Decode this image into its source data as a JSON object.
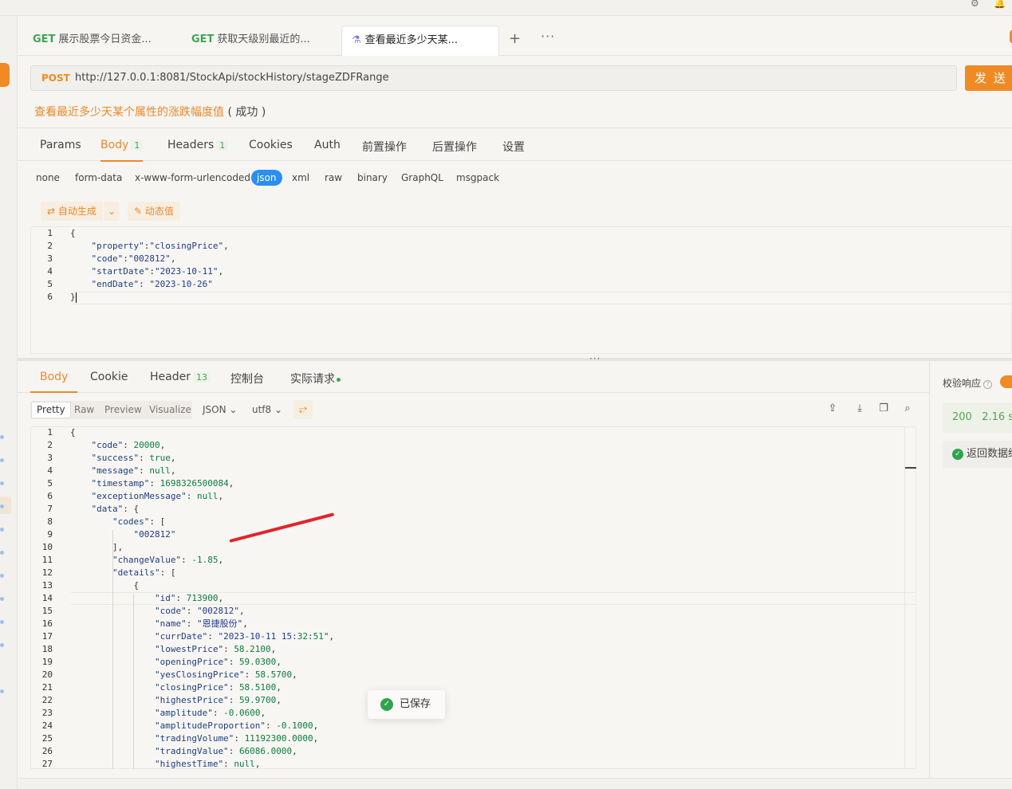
{
  "tabs": [
    {
      "method": "GET",
      "label": "展示股票今日资金..."
    },
    {
      "method": "GET",
      "label": "获取天级别最近的..."
    },
    {
      "method": "",
      "label": "查看最近多少天某..."
    }
  ],
  "request": {
    "method": "POST",
    "url": "http://127.0.0.1:8081/StockApi/stockHistory/stageZDFRange",
    "send_label": "发 送",
    "api_name": "查看最近多少天某个属性的涨跌幅度值",
    "api_status": "( 成功 )"
  },
  "req_tabs": [
    {
      "label": "Params",
      "count": ""
    },
    {
      "label": "Body",
      "count": "1"
    },
    {
      "label": "Headers",
      "count": "1"
    },
    {
      "label": "Cookies",
      "count": ""
    },
    {
      "label": "Auth",
      "count": ""
    },
    {
      "label": "前置操作",
      "count": ""
    },
    {
      "label": "后置操作",
      "count": ""
    },
    {
      "label": "设置",
      "count": ""
    }
  ],
  "body_types": [
    "none",
    "form-data",
    "x-www-form-urlencoded",
    "json",
    "xml",
    "raw",
    "binary",
    "GraphQL",
    "msgpack"
  ],
  "tools": {
    "auto_generate": "自动生成",
    "dynamic_value": "动态值"
  },
  "request_body": [
    "{",
    "    \"property\":\"closingPrice\",",
    "    \"code\":\"002812\",",
    "    \"startDate\":\"2023-10-11\",",
    "    \"endDate\": \"2023-10-26\"",
    "}"
  ],
  "resp_tabs": [
    {
      "label": "Body",
      "count": ""
    },
    {
      "label": "Cookie",
      "count": ""
    },
    {
      "label": "Header",
      "count": "13"
    },
    {
      "label": "控制台",
      "count": ""
    },
    {
      "label": "实际请求",
      "count": ""
    }
  ],
  "view_modes": [
    "Pretty",
    "Raw",
    "Preview",
    "Visualize"
  ],
  "format_select": "JSON",
  "encoding_select": "utf8",
  "response_body": [
    "{",
    "    \"code\": 20000,",
    "    \"success\": true,",
    "    \"message\": null,",
    "    \"timestamp\": 1698326500084,",
    "    \"exceptionMessage\": null,",
    "    \"data\": {",
    "        \"codes\": [",
    "            \"002812\"",
    "        ],",
    "        \"changeValue\": -1.85,",
    "        \"details\": [",
    "            {",
    "                \"id\": 713900,",
    "                \"code\": \"002812\",",
    "                \"name\": \"恩捷股份\",",
    "                \"currDate\": \"2023-10-11 15:32:51\",",
    "                \"lowestPrice\": 58.2100,",
    "                \"openingPrice\": 59.0300,",
    "                \"yesClosingPrice\": 58.5700,",
    "                \"closingPrice\": 58.5100,",
    "                \"highestPrice\": 59.9700,",
    "                \"amplitude\": -0.0600,",
    "                \"amplitudeProportion\": -0.1000,",
    "                \"tradingVolume\": 11192300.0000,",
    "                \"tradingValue\": 66086.0000,",
    "                \"highestTime\": null,"
  ],
  "toast": "已保存",
  "assert_panel": {
    "title": "校验响应",
    "status_code": "200",
    "time": "2.16 s",
    "result": "返回数据结构"
  },
  "colors": {
    "accent": "#f08a24",
    "success": "#2ea44f",
    "json_tab": "#2b8ef0"
  }
}
